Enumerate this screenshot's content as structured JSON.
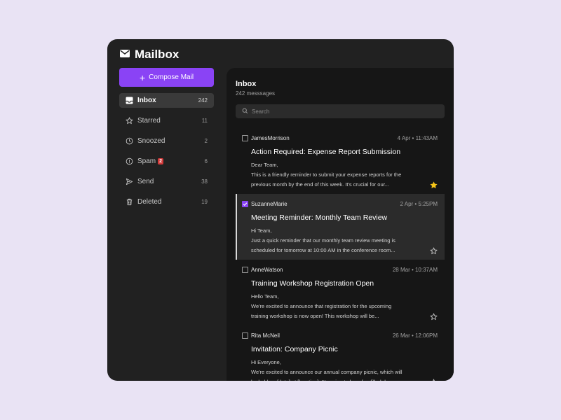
{
  "app": {
    "title": "Mailbox"
  },
  "compose": {
    "label": "Compose Mail"
  },
  "nav": {
    "items": [
      {
        "label": "Inbox",
        "count": "242",
        "icon": "inbox-icon",
        "active": true
      },
      {
        "label": "Starred",
        "count": "11",
        "icon": "star-icon"
      },
      {
        "label": "Snoozed",
        "count": "2",
        "icon": "clock-icon"
      },
      {
        "label": "Spam",
        "count": "6",
        "icon": "alert-circle-icon",
        "badge": "2"
      },
      {
        "label": "Send",
        "count": "38",
        "icon": "send-icon"
      },
      {
        "label": "Deleted",
        "count": "19",
        "icon": "trash-icon"
      }
    ]
  },
  "inbox": {
    "title": "Inbox",
    "count": "242 messsages"
  },
  "search": {
    "placeholder": "Search"
  },
  "mails": [
    {
      "sender": "JamesMorrison",
      "date": "4 Apr • 11:43AM",
      "subject": "Action Required: Expense Report Submission",
      "greeting": "Dear Team,",
      "body": "This is a friendly reminder to submit your expense reports for the previous month by the end of this week. It's crucial for our...",
      "starred": true,
      "selected": false
    },
    {
      "sender": "SuzanneMarie",
      "date": "2 Apr • 5:25PM",
      "subject": "Meeting Reminder: Monthly Team Review",
      "greeting": "Hi Team,",
      "body": "Just a quick reminder that our monthly team review meeting is scheduled for tomorrow at 10:00 AM in the conference room...",
      "starred": false,
      "selected": true
    },
    {
      "sender": "AnneWatson",
      "date": "28 Mar • 10:37AM",
      "subject": "Training Workshop Registration Open",
      "greeting": "Hello Team,",
      "body": "We're excited to announce that registration for the upcoming training workshop is now open! This workshop will be...",
      "starred": false,
      "selected": false
    },
    {
      "sender": "Rita McNeil",
      "date": "26 Mar • 12:06PM",
      "subject": "Invitation: Company Picnic",
      "greeting": "Hi Everyone,",
      "body": "We're excited to announce our annual company picnic, which will be held on [date] at [location]. It's going to be a fun-filled day...",
      "starred": false,
      "selected": false
    }
  ],
  "colors": {
    "background": "#e9e3f4",
    "panel": "#212121",
    "main": "#161616",
    "accent": "#8a43f5",
    "star": "#f5c518",
    "badge": "#d33a3a"
  }
}
